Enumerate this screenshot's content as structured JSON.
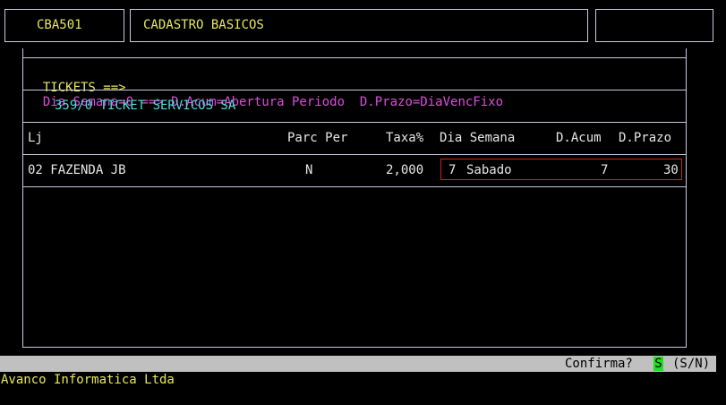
{
  "header": {
    "program_code": "CBA501",
    "title": "CADASTRO BASICOS",
    "right_box": ""
  },
  "info_line": {
    "tickets_label": "TICKETS ==>",
    "rule_text": "Dia Semana=0 ==> D.Acum=Abertura Periodo  D.Prazo=DiaVencFixo"
  },
  "company": "359/0 TICKET SERVICOS SA",
  "table": {
    "columns": [
      "Lj",
      "Parc Per",
      "Taxa%",
      "Dia Semana",
      "D.Acum",
      "D.Prazo"
    ],
    "rows": [
      {
        "loja": "02 FAZENDA JB",
        "parc_per": "N",
        "taxa": "2,000",
        "dia_num": "7",
        "dia_nome": "Sabado",
        "d_acum": "7",
        "d_prazo": "30"
      }
    ]
  },
  "status_bar": {
    "prompt": "Confirma?",
    "answer": "S",
    "options": "(S/N)"
  },
  "footer": "Avanco Informatica Ltda",
  "colors": {
    "yellow": "#e8e85a",
    "magenta": "#d84fd8",
    "cyan": "#4fd8d8",
    "status_bg": "#c0c0c0",
    "cursor_green": "#22dd22",
    "highlight_red": "#d02020"
  }
}
